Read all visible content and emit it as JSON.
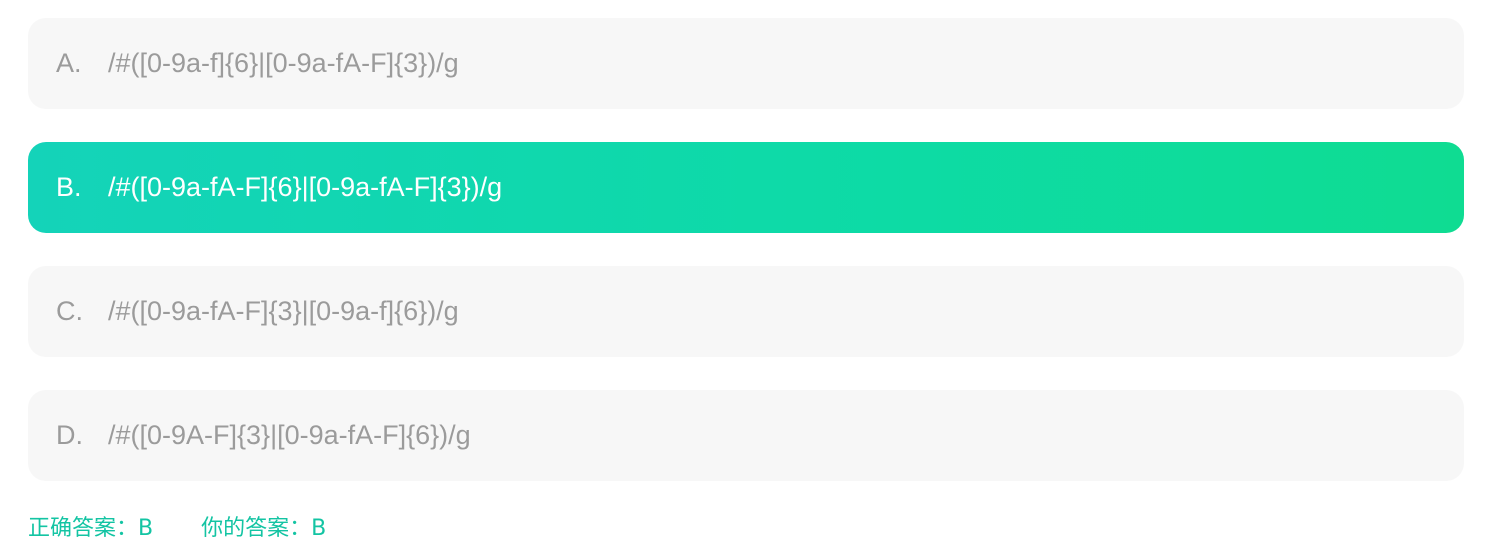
{
  "options": [
    {
      "letter": "A.",
      "text": "/#([0-9a-f]{6}|[0-9a-fA-F]{3})/g",
      "selected": false
    },
    {
      "letter": "B.",
      "text": "/#([0-9a-fA-F]{6}|[0-9a-fA-F]{3})/g",
      "selected": true
    },
    {
      "letter": "C.",
      "text": "/#([0-9a-fA-F]{3}|[0-9a-f]{6})/g",
      "selected": false
    },
    {
      "letter": "D.",
      "text": "/#([0-9A-F]{3}|[0-9a-fA-F]{6})/g",
      "selected": false
    }
  ],
  "result": {
    "correct_answer": "正确答案：B",
    "your_answer": "你的答案：B"
  },
  "colors": {
    "selected_gradient_start": "#14d3b9",
    "selected_gradient_end": "#0fdc92",
    "option_background": "#f7f7f7",
    "option_text": "#9b9b9b",
    "answer_text": "#13c4a3"
  }
}
